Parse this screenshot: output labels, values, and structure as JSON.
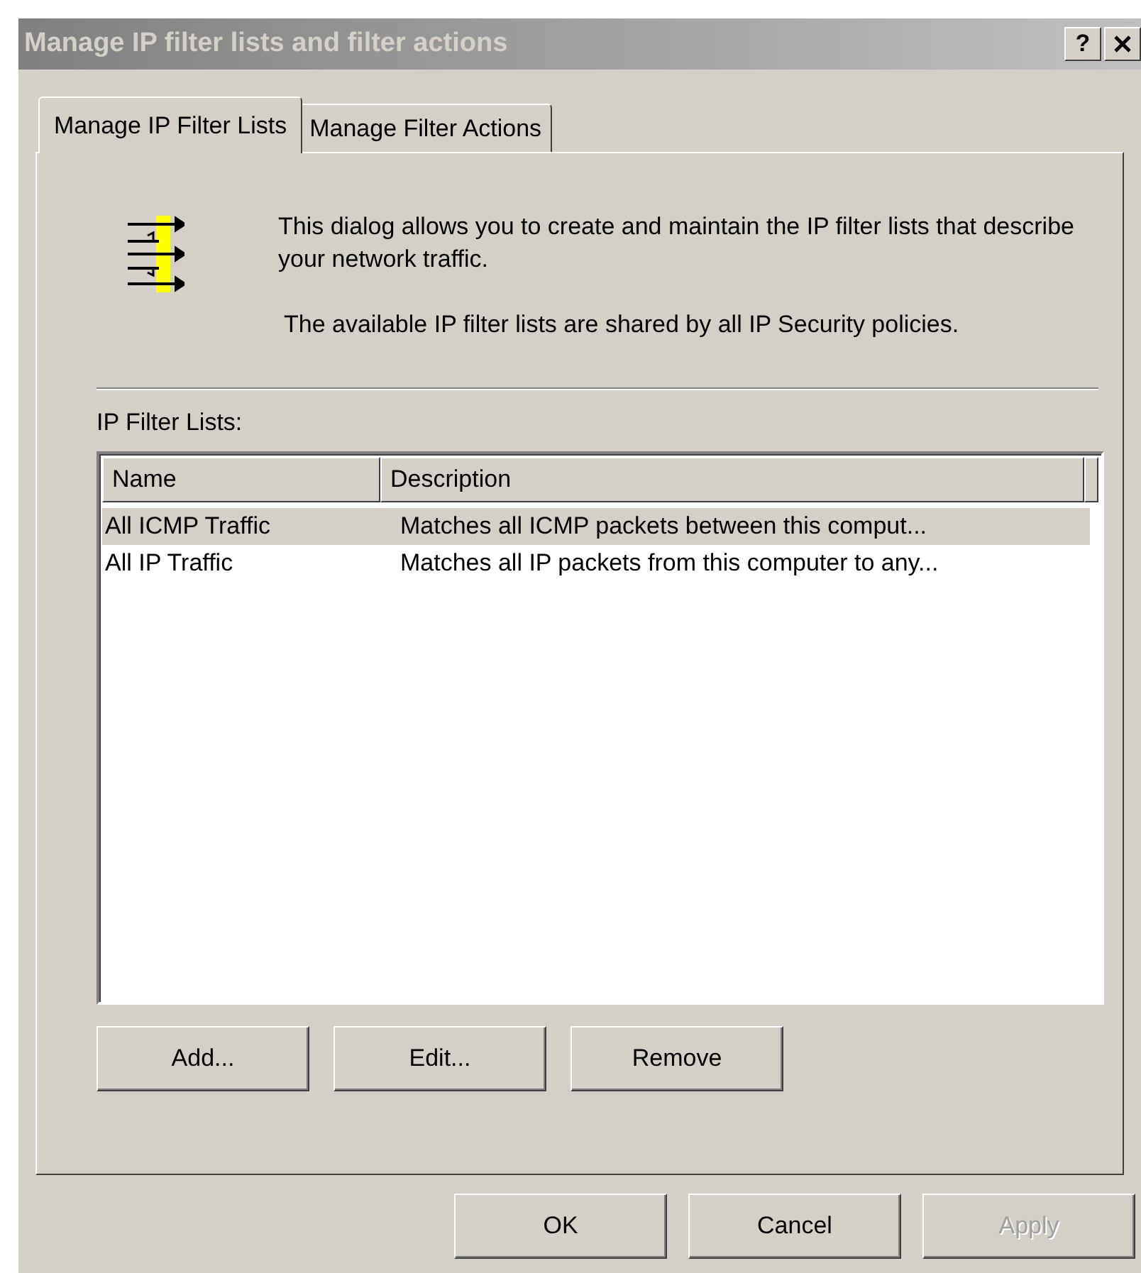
{
  "window": {
    "title": "Manage IP filter lists and filter actions",
    "help_button": "?"
  },
  "tabs": [
    {
      "label": "Manage IP Filter Lists",
      "selected": true
    },
    {
      "label": "Manage Filter Actions",
      "selected": false
    }
  ],
  "intro": [
    "This dialog allows you to create and maintain the IP filter lists that describe your network traffic.",
    "The available IP filter lists are shared by all IP Security policies."
  ],
  "list": {
    "label": "IP Filter Lists:",
    "columns": [
      "Name",
      "Description"
    ],
    "rows": [
      {
        "name": "All ICMP Traffic",
        "description": "Matches all ICMP packets between this comput...",
        "selected": true
      },
      {
        "name": "All IP Traffic",
        "description": "Matches all IP packets from this computer to any...",
        "selected": false
      }
    ]
  },
  "list_buttons": [
    {
      "label": "Add...",
      "disabled": false
    },
    {
      "label": "Edit...",
      "disabled": false
    },
    {
      "label": "Remove",
      "disabled": false
    }
  ],
  "dialog_buttons": [
    {
      "label": "OK",
      "disabled": false
    },
    {
      "label": "Cancel",
      "disabled": false
    },
    {
      "label": "Apply",
      "disabled": true
    }
  ]
}
